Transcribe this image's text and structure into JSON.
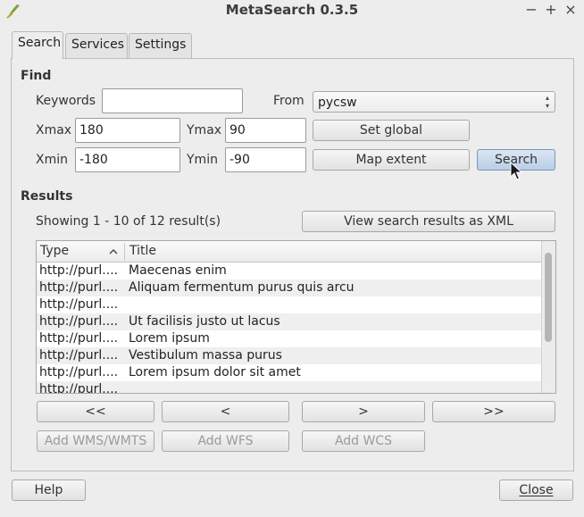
{
  "window": {
    "title": "MetaSearch 0.3.5",
    "controls": {
      "minimize": "−",
      "maximize": "+",
      "close": "×"
    }
  },
  "tabs": [
    {
      "label": "Search",
      "active": true
    },
    {
      "label": "Services",
      "active": false
    },
    {
      "label": "Settings",
      "active": false
    }
  ],
  "find": {
    "heading": "Find",
    "keywords_label": "Keywords",
    "keywords_value": "",
    "from_label": "From",
    "from_value": "pycsw",
    "xmax_label": "Xmax",
    "xmax_value": "180",
    "ymax_label": "Ymax",
    "ymax_value": "90",
    "xmin_label": "Xmin",
    "xmin_value": "-180",
    "ymin_label": "Ymin",
    "ymin_value": "-90",
    "set_global": "Set global",
    "map_extent": "Map extent",
    "search": "Search"
  },
  "results": {
    "heading": "Results",
    "status": "Showing 1 - 10 of 12 result(s)",
    "view_xml": "View search results as XML",
    "columns": {
      "type": "Type",
      "title": "Title"
    },
    "rows": [
      {
        "type": "http://purl....",
        "title": "Maecenas enim"
      },
      {
        "type": "http://purl....",
        "title": "Aliquam fermentum purus quis arcu"
      },
      {
        "type": "http://purl....",
        "title": ""
      },
      {
        "type": "http://purl....",
        "title": "Ut facilisis justo ut lacus"
      },
      {
        "type": "http://purl....",
        "title": "Lorem ipsum"
      },
      {
        "type": "http://purl....",
        "title": "Vestibulum massa purus"
      },
      {
        "type": "http://purl....",
        "title": "Lorem ipsum dolor sit amet"
      },
      {
        "type": "http://purl....",
        "title": ""
      }
    ]
  },
  "nav": {
    "first": "<<",
    "prev": "<",
    "next": ">",
    "last": ">>"
  },
  "add": {
    "wms": "Add WMS/WMTS",
    "wfs": "Add WFS",
    "wcs": "Add WCS"
  },
  "footer": {
    "help": "Help",
    "close": "Close"
  }
}
